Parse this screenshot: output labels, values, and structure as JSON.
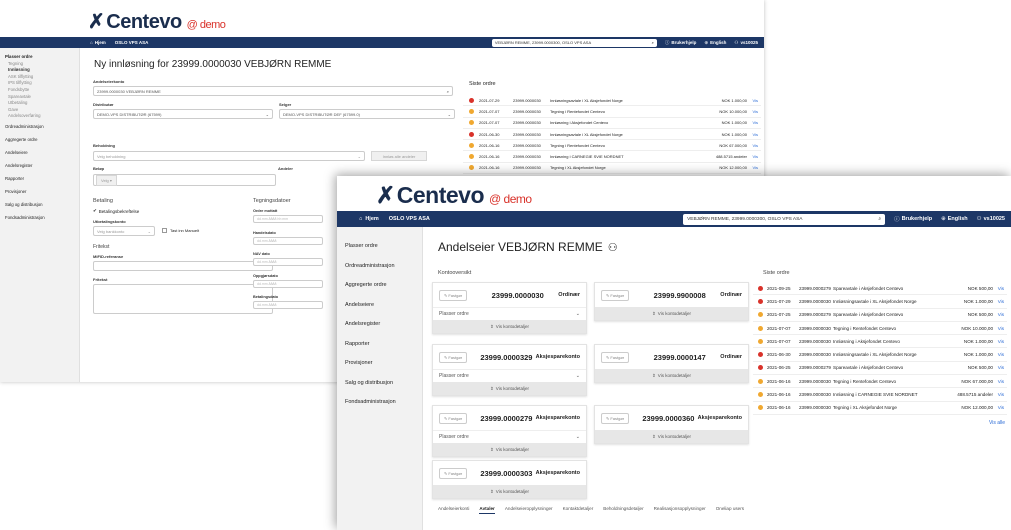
{
  "brand": {
    "name": "Centevo",
    "demo": "@ demo"
  },
  "nav": {
    "home": "Hjem",
    "company": "OSLO VPS ASA",
    "help": "Brukerhjelp",
    "lang": "English",
    "user": "vs10025"
  },
  "w1": {
    "search_value": "VEBJØRN REMME, 23999.0000300, OSLO VPS ASA",
    "sidebar": {
      "place_orders": "Plasser ordre",
      "subs": [
        "Tegning",
        "Innløsning",
        "ASK tilflytting",
        "IPS tilflytting",
        "Fondsbytte",
        "Spareavtale",
        "Utbetaling",
        "Gave",
        "Andelsoverføring"
      ],
      "items": [
        "Ordreadministrasjon",
        "Aggregerte ordre",
        "Andelseiere",
        "Andelsregister",
        "Rapporter",
        "Provisjoner",
        "Salg og distribusjon",
        "Fondsadministrasjon"
      ]
    },
    "title": "Ny innløsning for 23999.0000030 VEBJØRN REMME",
    "form": {
      "account_label": "Andelseierkonto",
      "account_value": "23999.0000030 VEBJØRN REMME",
      "distributor_label": "Distributør",
      "distributor_value": "DEMO-VPS DISTRIBUTØR (67599)",
      "seller_label": "Selger",
      "seller_value": "DEMO-VPS DISTRIBUTØR DEF (67599.0)",
      "holding_label": "Beholdning",
      "holding_placeholder": "Velg beholdning",
      "sell_all": "Innløs alle andeler",
      "amount_label": "Beløp",
      "shares_label": "Andeler",
      "currency": "Velg",
      "payment_head": "Betaling",
      "payment_confirm": "Betalingsbekreftelse",
      "payout_account_label": "Utbetalingskonto",
      "payout_account_placeholder": "Velg bankkonto",
      "manual_label": "Tast inn Manuelt",
      "freetext_head": "Fritekst",
      "mifid_label": "MiFID-referanse",
      "freetext_label": "Fritekst",
      "dates_head": "Tegningsdatoer",
      "order_received": "Ordre mottatt",
      "trade_date": "Handelsdato",
      "nav_date": "NAV dato",
      "settle_date": "Oppgjørsdato",
      "pay_date": "Betalingsdato",
      "date_placeholder": "dd.mm.åååå",
      "time_placeholder": "dd.mm.åååå hh:mm"
    },
    "recent_title": "Siste ordre",
    "orders": [
      {
        "date": "2021-07-29",
        "acct": "23999.0000030",
        "desc": "Innløsningsavtale i XL Aksjefondet Norge",
        "amount": "NOK 1.000,00",
        "link": "Vis",
        "status": "red"
      },
      {
        "date": "2021-07-07",
        "acct": "23999.0000030",
        "desc": "Tegning i Rentefondet Centevo",
        "amount": "NOK 10.000,00",
        "link": "Vis",
        "status": "orange"
      },
      {
        "date": "2021-07-07",
        "acct": "23999.0000030",
        "desc": "Innløsning i Aksjefondet Centevo",
        "amount": "NOK 1.000,00",
        "link": "Vis",
        "status": "orange"
      },
      {
        "date": "2021-06-30",
        "acct": "23999.0000030",
        "desc": "Innløsningsavtale i XL Aksjefondet Norge",
        "amount": "NOK 1.000,00",
        "link": "Vis",
        "status": "red"
      },
      {
        "date": "2021-06-16",
        "acct": "23999.0000030",
        "desc": "Tegning i Rentefondet Centevo",
        "amount": "NOK 67.000,00",
        "link": "Vis",
        "status": "orange"
      },
      {
        "date": "2021-06-16",
        "acct": "23999.0000030",
        "desc": "Innløsning i CARNEGIE SVIE NORDNET",
        "amount": "488.5715 andeler",
        "link": "Vis",
        "status": "orange"
      },
      {
        "date": "2021-06-16",
        "acct": "23999.0000030",
        "desc": "Tegning i XL Aksjefondet Norge",
        "amount": "NOK 12.000,00",
        "link": "Vis",
        "status": "orange"
      }
    ]
  },
  "w2": {
    "search_value": "VEBJØRN REMME, 23999.0000300, OSLO VPS ASA",
    "sidebar": [
      "Plasser ordre",
      "Ordreadministrasjon",
      "Aggregerte ordre",
      "Andelseiere",
      "Andelsregister",
      "Rapporter",
      "Provisjoner",
      "Salg og distribusjon",
      "Fondsadministrasjon"
    ],
    "title": "Andelseier VEBJØRN REMME",
    "overview_title": "Kontooversikt",
    "accounts": [
      {
        "num": "23999.0000030",
        "type": "Ordinær",
        "flag": "Fastgør",
        "place": "Plasser ordre",
        "details": "Vis kontodetaljer"
      },
      {
        "num": "23999.9900008",
        "type": "Ordinær",
        "flag": "Fastgør",
        "place": "",
        "details": "Vis kontodetaljer"
      },
      {
        "num": "23999.0000329",
        "type": "Aksjesparekonto",
        "flag": "Fastgør",
        "place": "Plasser ordre",
        "details": "Vis kontodetaljer"
      },
      {
        "num": "23999.0000147",
        "type": "Ordinær",
        "flag": "Fastgør",
        "place": "",
        "details": "Vis kontodetaljer"
      },
      {
        "num": "23999.0000279",
        "type": "Aksjesparekonto",
        "flag": "Fastgør",
        "place": "Plasser ordre",
        "details": "Vis kontodetaljer"
      },
      {
        "num": "23999.0000360",
        "type": "Aksjesparekonto",
        "flag": "Fastgør",
        "place": "",
        "details": "Vis kontodetaljer"
      },
      {
        "num": "23999.0000303",
        "type": "Aksjesparekonto",
        "flag": "Fastgør",
        "place": "",
        "details": "Vis kontodetaljer"
      }
    ],
    "recent_title": "Siste ordre",
    "orders": [
      {
        "date": "2021-09-25",
        "acct": "23999.0000279",
        "desc": "Spareavtale i Aksjefondet Centevo",
        "amount": "NOK 500,00",
        "link": "Vis",
        "status": "red"
      },
      {
        "date": "2021-07-29",
        "acct": "23999.0000030",
        "desc": "Innløsningsavtale i XL Aksjefondet Norge",
        "amount": "NOK 1.000,00",
        "link": "Vis",
        "status": "red"
      },
      {
        "date": "2021-07-25",
        "acct": "23999.0000279",
        "desc": "Spareavtale i Aksjefondet Centevo",
        "amount": "NOK 500,00",
        "link": "Vis",
        "status": "orange"
      },
      {
        "date": "2021-07-07",
        "acct": "23999.0000030",
        "desc": "Tegning i Rentefondet Centevo",
        "amount": "NOK 10.000,00",
        "link": "Vis",
        "status": "orange"
      },
      {
        "date": "2021-07-07",
        "acct": "23999.0000030",
        "desc": "Innløsning i Aksjefondet Centevo",
        "amount": "NOK 1.000,00",
        "link": "Vis",
        "status": "orange"
      },
      {
        "date": "2021-06-30",
        "acct": "23999.0000030",
        "desc": "Innløsningsavtale i XL Aksjefondet Norge",
        "amount": "NOK 1.000,00",
        "link": "Vis",
        "status": "red"
      },
      {
        "date": "2021-06-25",
        "acct": "23999.0000279",
        "desc": "Spareavtale i Aksjefondet Centevo",
        "amount": "NOK 500,00",
        "link": "Vis",
        "status": "red"
      },
      {
        "date": "2021-06-16",
        "acct": "23999.0000030",
        "desc": "Tegning i Rentefondet Centevo",
        "amount": "NOK 67.000,00",
        "link": "Vis",
        "status": "orange"
      },
      {
        "date": "2021-06-16",
        "acct": "23999.0000030",
        "desc": "Innløsning i CARNEGIE SVIE NORDNET",
        "amount": "488.5715 andeler",
        "link": "Vis",
        "status": "orange"
      },
      {
        "date": "2021-06-16",
        "acct": "23999.0000030",
        "desc": "Tegning i XL Aksjefondet Norge",
        "amount": "NOK 12.000,00",
        "link": "Vis",
        "status": "orange"
      }
    ],
    "show_all": "Vis alle",
    "tabs": [
      "Andelseierkonti",
      "Avtaler",
      "Andelseieropplysninger",
      "Kontaktdetaljer",
      "Beholdningsdetaljer",
      "Realisasjonsopplysninger",
      "Oneliap users"
    ]
  }
}
